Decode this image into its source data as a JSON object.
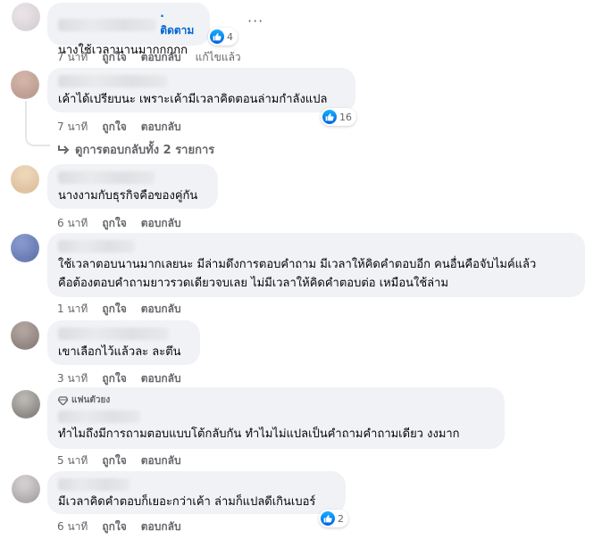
{
  "comments": [
    {
      "follow_label": "· ติดตาม",
      "text": "นางใช้เวลานานมากกกกก",
      "time": "7 นาที",
      "like": "ถูกใจ",
      "reply": "ตอบกลับ",
      "edited": "แก้ไขแล้ว",
      "reactions": "4",
      "avatar_color": "#d8d4d8"
    },
    {
      "text": "เค้าได้เปรียบนะ เพราะเค้ามีเวลาคิดตอนล่ามกำลังแปล",
      "time": "7 นาที",
      "like": "ถูกใจ",
      "reply": "ตอบกลับ",
      "reactions": "16",
      "view_replies": "ดูการตอบกลับทั้ง 2 รายการ",
      "avatar_color": "#c9a99a"
    },
    {
      "text": "นางงามกับธุรกิจคือของคู่กัน",
      "time": "6 นาที",
      "like": "ถูกใจ",
      "reply": "ตอบกลับ",
      "avatar_color": "#e3c9a6"
    },
    {
      "text_lines": [
        "ใช้เวลาตอบนานมากเลยนะ มีล่ามดึงการตอบคำถาม มีเวลาให้คิดคำตอบอีก คนอื่นคือจับไมค์แล้ว",
        "คือต้องตอบคำถามยาวรวดเดียวจบเลย ไม่มีเวลาให้คิดคำตอบต่อ เหมือนใช้ล่าม"
      ],
      "time": "1 นาที",
      "like": "ถูกใจ",
      "reply": "ตอบกลับ",
      "avatar_color": "#6b7fb8"
    },
    {
      "text": "เขาเลือกไว้แล้วละ ละตึน",
      "time": "3 นาที",
      "like": "ถูกใจ",
      "reply": "ตอบกลับ",
      "avatar_color": "#9a8b86"
    },
    {
      "badge": "แฟนตัวยง",
      "text": "ทำไมถึงมีการถามตอบแบบโต้กลับกัน ทำไมไม่แปลเป็นคำถามคำถามเดียว งงมาก",
      "time": "5 นาที",
      "like": "ถูกใจ",
      "reply": "ตอบกลับ",
      "avatar_color": "#8e8a86"
    },
    {
      "text": "มีเวลาคิดคำตอบก็เยอะกว่าเค้า ล่ามก็แปลดีเกินเบอร์",
      "time": "6 นาที",
      "like": "ถูกใจ",
      "reply": "ตอบกลับ",
      "reactions": "2",
      "avatar_color": "#a8a4a6"
    }
  ]
}
